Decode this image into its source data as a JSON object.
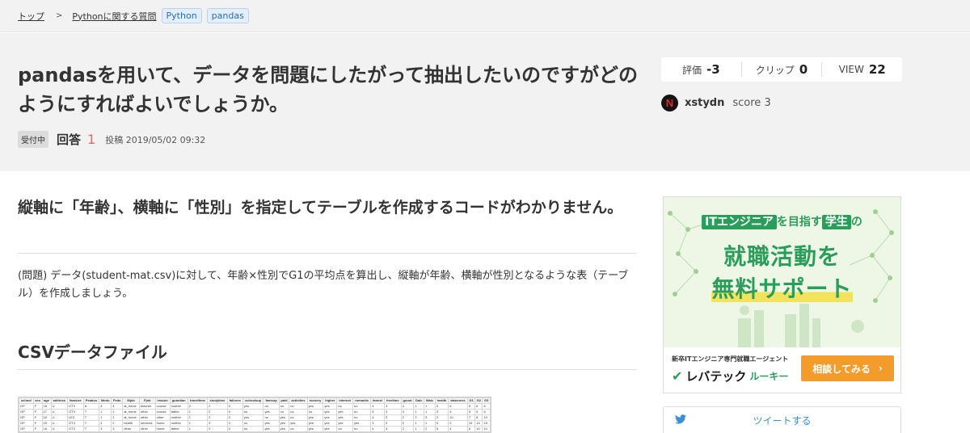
{
  "breadcrumb": {
    "home": "トップ",
    "category": "Pythonに関する質問",
    "tags": [
      "Python",
      "pandas"
    ]
  },
  "question": {
    "title": "pandasを用いて、データを問題にしたがって抽出したいのですがどのようにすればよいでしょうか。",
    "status_badge": "受付中",
    "answers_label": "回答",
    "answers_count": "1",
    "posted_label": "投稿",
    "posted_date": "2019/05/02 09:32"
  },
  "stats": {
    "rating_label": "評価",
    "rating_value": "-3",
    "clip_label": "クリップ",
    "clip_value": "0",
    "view_label": "VIEW",
    "view_value": "22"
  },
  "user": {
    "avatar_letter": "N",
    "name": "xstydn",
    "score_label": "score",
    "score_value": "3"
  },
  "body": {
    "heading": "縦軸に「年齢」、横軸に「性別」を指定してテーブルを作成するコードがわかりません。",
    "paragraph": "(問題) データ(student-mat.csv)に対して、年齢×性別でG1の平均点を算出し、縦軸が年齢、横軸が性別となるような表（テーブル）を作成しましょう。",
    "section_heading": "CSVデータファイル",
    "csv_header": [
      "school",
      "sex",
      "age",
      "address",
      "famsize",
      "Pstatus",
      "Medu",
      "Fedu",
      "Mjob",
      "Fjob",
      "reason",
      "guardian",
      "traveltime",
      "studytime",
      "failures",
      "schoolsup",
      "famsup",
      "paid",
      "activities",
      "nursery",
      "higher",
      "internet",
      "romantic",
      "famrel",
      "freetime",
      "goout",
      "Dalc",
      "Walc",
      "health",
      "absences",
      "G1",
      "G2",
      "G3"
    ],
    "csv_rows": [
      [
        "GP",
        "F",
        "18",
        "U",
        "GT3",
        "A",
        "4",
        "4",
        "at_home",
        "teacher",
        "course",
        "mother",
        "2",
        "2",
        "0",
        "yes",
        "no",
        "no",
        "no",
        "yes",
        "yes",
        "no",
        "no",
        "4",
        "3",
        "4",
        "1",
        "1",
        "3",
        "6",
        "5",
        "6",
        "6"
      ],
      [
        "GP",
        "F",
        "17",
        "U",
        "GT3",
        "T",
        "1",
        "1",
        "at_home",
        "other",
        "course",
        "father",
        "1",
        "2",
        "0",
        "no",
        "yes",
        "no",
        "no",
        "no",
        "yes",
        "yes",
        "no",
        "5",
        "3",
        "3",
        "1",
        "1",
        "3",
        "4",
        "5",
        "5",
        "6"
      ],
      [
        "GP",
        "F",
        "15",
        "U",
        "LE3",
        "T",
        "1",
        "1",
        "at_home",
        "other",
        "other",
        "mother",
        "1",
        "2",
        "3",
        "yes",
        "no",
        "yes",
        "no",
        "yes",
        "yes",
        "yes",
        "no",
        "4",
        "3",
        "2",
        "2",
        "3",
        "3",
        "10",
        "7",
        "8",
        "10"
      ],
      [
        "GP",
        "F",
        "15",
        "U",
        "GT3",
        "T",
        "4",
        "2",
        "health",
        "services",
        "home",
        "mother",
        "1",
        "3",
        "0",
        "no",
        "yes",
        "yes",
        "yes",
        "yes",
        "yes",
        "yes",
        "yes",
        "3",
        "2",
        "2",
        "1",
        "1",
        "5",
        "2",
        "15",
        "14",
        "15"
      ],
      [
        "GP",
        "F",
        "16",
        "U",
        "GT3",
        "T",
        "3",
        "3",
        "other",
        "other",
        "home",
        "father",
        "1",
        "2",
        "0",
        "no",
        "yes",
        "yes",
        "no",
        "yes",
        "yes",
        "no",
        "no",
        "4",
        "3",
        "2",
        "1",
        "2",
        "5",
        "4",
        "6",
        "10",
        "10"
      ]
    ]
  },
  "ad": {
    "line1_a": "ITエンジニア",
    "line1_b": "を目指す",
    "line1_c": "学生",
    "line1_d": "の",
    "line2": "就職活動を",
    "line3": "無料サポート",
    "subtitle": "新卒ITエンジニア専門就職エージェント",
    "brand": "レバテック",
    "brand_sub": "ルーキー",
    "cta": "相談してみる"
  },
  "share": {
    "tweet_label": "ツイートする"
  },
  "colors": {
    "accent_green": "#2a9d5b",
    "cta_orange": "#f39c2b",
    "answers_red": "#e06666",
    "tag_blue": "#2b6cb0"
  }
}
